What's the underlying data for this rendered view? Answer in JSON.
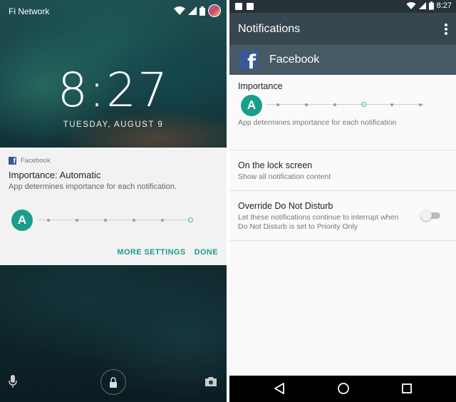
{
  "lockscreen": {
    "carrier": "Fi Network",
    "time": "8:27",
    "date": "TUESDAY, AUGUST 9",
    "notification": {
      "app_name": "Facebook",
      "title": "Importance: Automatic",
      "description": "App determines importance for each notification.",
      "badge_letter": "A",
      "importance_level": "automatic",
      "more_settings_label": "MORE SETTINGS",
      "done_label": "DONE"
    },
    "icons": [
      "wifi-icon",
      "signal-icon",
      "battery-icon",
      "avatar",
      "mic-icon",
      "lock-icon",
      "camera-icon"
    ]
  },
  "settings": {
    "status_time": "8:27",
    "toolbar_title": "Notifications",
    "app_name": "Facebook",
    "importance": {
      "title": "Importance",
      "badge_letter": "A",
      "description": "App determines importance for each notification"
    },
    "lock_screen": {
      "title": "On the lock screen",
      "value": "Show all notification content"
    },
    "dnd": {
      "title": "Override Do Not Disturb",
      "line1": "Let these notifications continue to interrupt when",
      "line2": "Do Not Disturb is set to Priority Only",
      "enabled": false
    },
    "nav": [
      "back-icon",
      "home-icon",
      "recents-icon"
    ]
  },
  "colors": {
    "accent": "#1a9e8c",
    "toolbar": "#37474f",
    "app_header": "#455a64",
    "status_bar": "#273238",
    "facebook_blue": "#3b5998"
  }
}
